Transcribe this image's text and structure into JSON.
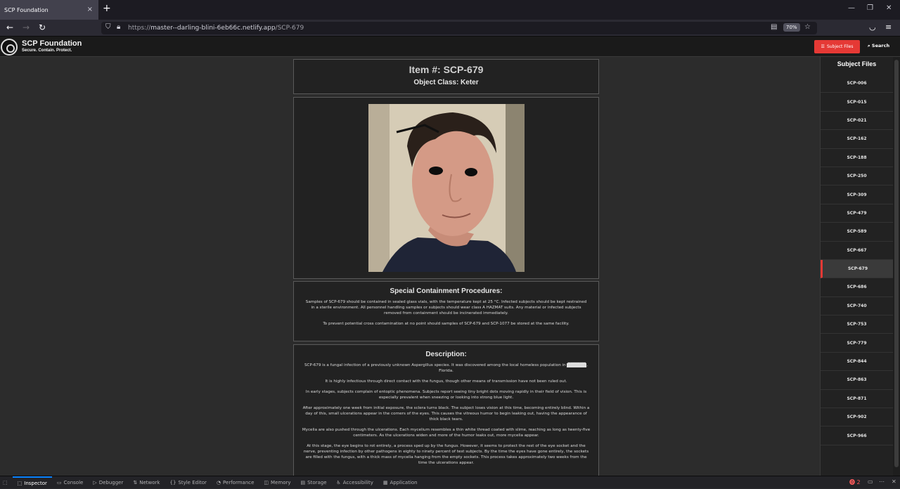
{
  "browser": {
    "tab_title": "SCP Foundation",
    "tab_close": "×",
    "new_tab": "+",
    "url_prefix": "https://",
    "url_domain": "master--darling-blini-6eb66c.netlify.app",
    "url_path": "/SCP-679",
    "zoom": "70%",
    "window_controls": [
      "—",
      "❐",
      "✕"
    ]
  },
  "site": {
    "title": "SCP Foundation",
    "tagline": "Secure. Contain. Protect.",
    "subject_files_button": "Subject Files",
    "search_button": "Search",
    "accent_color": "#e53935"
  },
  "item": {
    "number": "Item #: SCP-679",
    "object_class": "Object Class: Keter"
  },
  "procedures": {
    "title": "Special Containment Procedures:",
    "paragraphs": [
      "Samples of SCP-679 should be contained in sealed glass vials, with the temperature kept at 25 °C. Infected subjects should be kept restrained in a sterile environment. All personnel handling samples or subjects should wear class A HAZMAT suits. Any material or infected subjects removed from containment should be incinerated immediately.",
      "To prevent potential cross contamination at no point should samples of SCP-679 and SCP-1077 be stored at the same facility."
    ]
  },
  "description": {
    "title": "Description:",
    "p1_before": "SCP-679 is a fungal infection of a previously unknown Aspergillus species. It was discovered among the local homeless population in ",
    "p1_redacted": "██████",
    "p1_after": ", Florida.",
    "paragraphs": [
      "It is highly infectious through direct contact with the fungus, though other means of transmission have not been ruled out.",
      "In early stages, subjects complain of entoptic phenomena. Subjects report seeing tiny bright dots moving rapidly in their field of vision. This is especially prevalent when sneezing or looking into strong blue light.",
      "After approximately one week from initial exposure, the sclera turns black. The subject loses vision at this time, becoming entirely blind. Within a day of this, small ulcerations appear in the corners of the eyes. This causes the vitreous humor to begin leaking out, having the appearance of thick black tears.",
      "Mycelia are also pushed through the ulcerations. Each mycelium resembles a thin white thread coated with slime, reaching as long as twenty-five centimeters. As the ulcerations widen and more of the humor leaks out, more mycelia appear.",
      "At this stage, the eye begins to rot entirely, a process sped up by the fungus. However, it seems to protect the rest of the eye socket and the nerve, preventing infection by other pathogens in eighty to ninety percent of test subjects. By the time the eyes have gone entirely, the sockets are filled with the fungus, with a thick mass of mycelia hanging from the empty sockets. This process takes approximately two weeks from the time the ulcerations appear."
    ]
  },
  "sidebar": {
    "title": "Subject Files",
    "items": [
      "SCP-006",
      "SCP-015",
      "SCP-021",
      "SCP-162",
      "SCP-188",
      "SCP-250",
      "SCP-309",
      "SCP-479",
      "SCP-589",
      "SCP-667",
      "SCP-679",
      "SCP-686",
      "SCP-740",
      "SCP-753",
      "SCP-779",
      "SCP-844",
      "SCP-863",
      "SCP-871",
      "SCP-902",
      "SCP-966"
    ],
    "active": "SCP-679"
  },
  "devtools": {
    "tabs": [
      "Inspector",
      "Console",
      "Debugger",
      "Network",
      "Style Editor",
      "Performance",
      "Memory",
      "Storage",
      "Accessibility",
      "Application"
    ],
    "active_tab": "Inspector",
    "error_count": "2"
  }
}
